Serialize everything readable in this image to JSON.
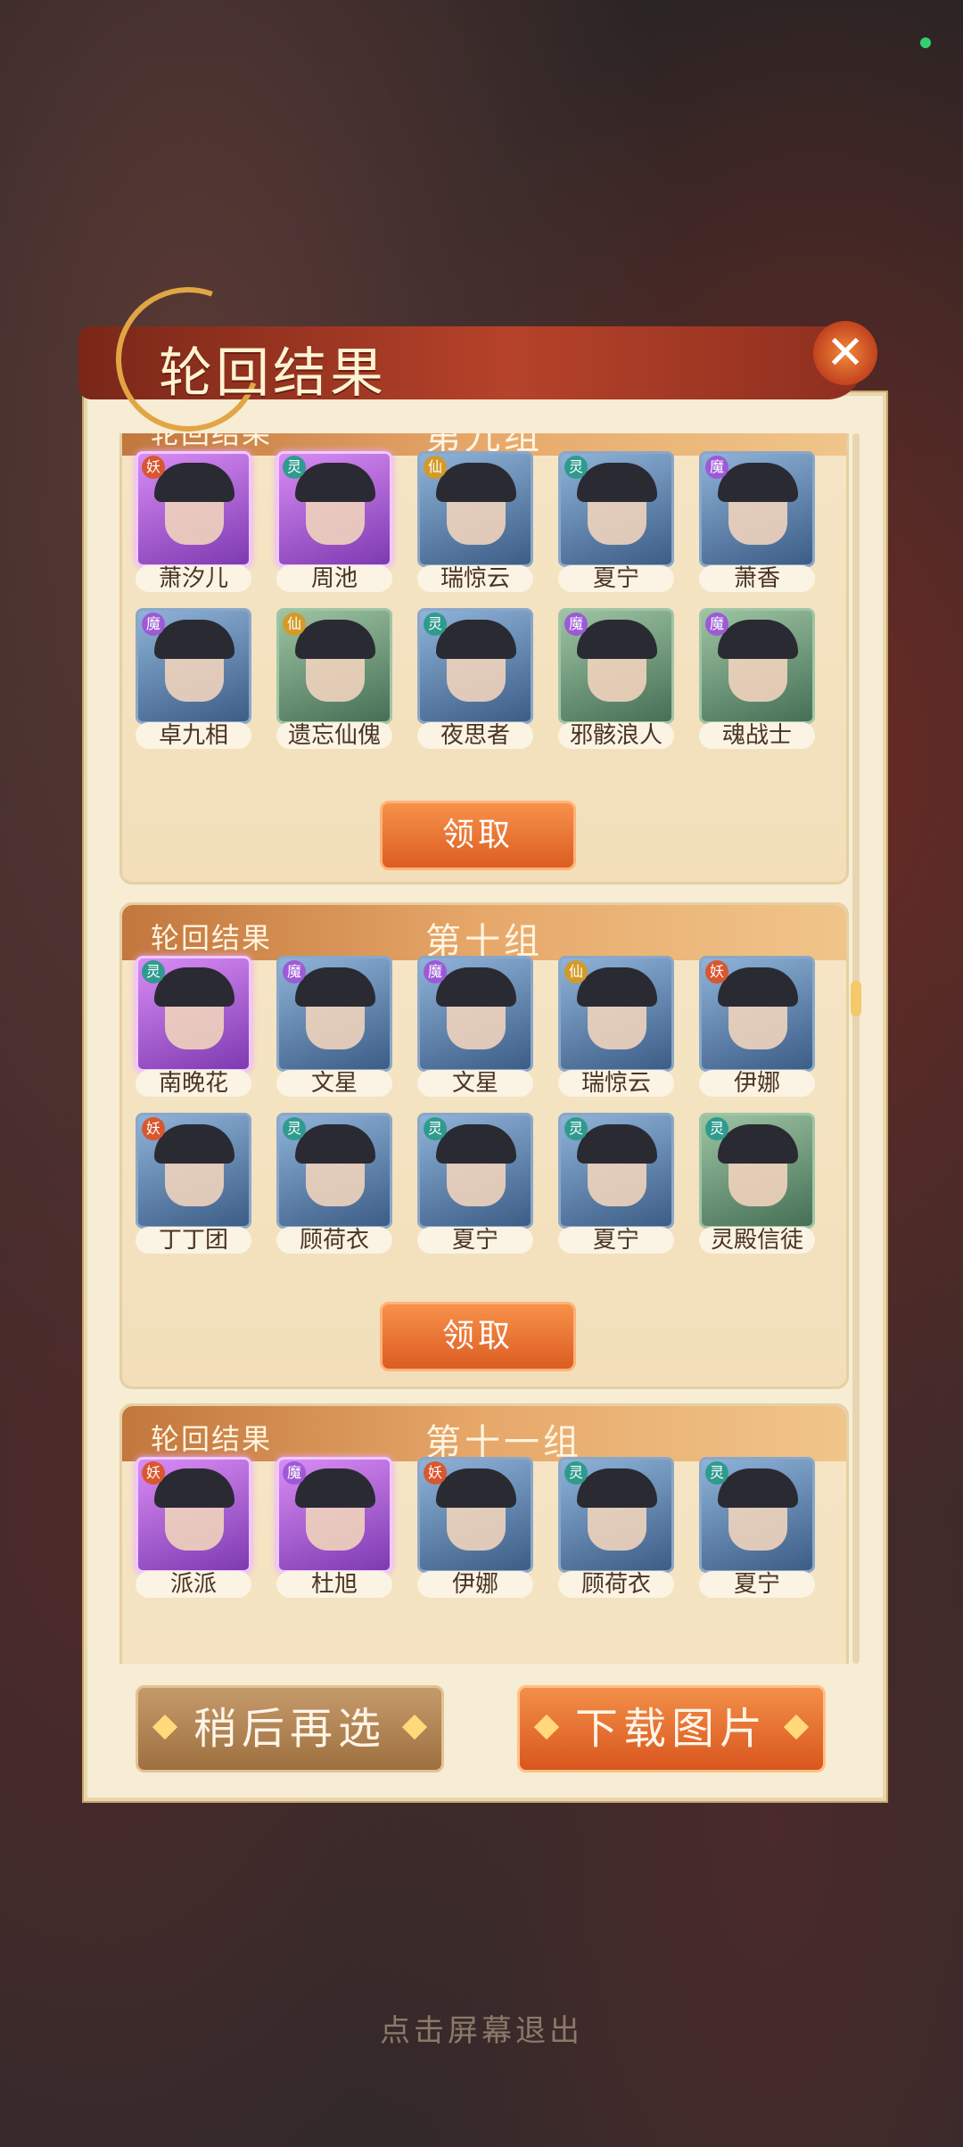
{
  "title": "轮回结果",
  "group_label": "轮回结果",
  "groups": [
    {
      "name": "第九组",
      "cards": [
        {
          "name": "萧汐儿",
          "badge": "妖"
        },
        {
          "name": "周池",
          "badge": "灵"
        },
        {
          "name": "瑞惊云",
          "badge": "仙"
        },
        {
          "name": "夏宁",
          "badge": "灵"
        },
        {
          "name": "萧香",
          "badge": "魔"
        },
        {
          "name": "卓九相",
          "badge": "魔"
        },
        {
          "name": "遗忘仙傀",
          "badge": "仙"
        },
        {
          "name": "夜思者",
          "badge": "灵"
        },
        {
          "name": "邪骸浪人",
          "badge": "魔"
        },
        {
          "name": "魂战士",
          "badge": "魔"
        }
      ],
      "claim": "领取"
    },
    {
      "name": "第十组",
      "cards": [
        {
          "name": "南晚花",
          "badge": "灵"
        },
        {
          "name": "文星",
          "badge": "魔"
        },
        {
          "name": "文星",
          "badge": "魔"
        },
        {
          "name": "瑞惊云",
          "badge": "仙"
        },
        {
          "name": "伊娜",
          "badge": "妖"
        },
        {
          "name": "丁丁团",
          "badge": "妖"
        },
        {
          "name": "顾荷衣",
          "badge": "灵"
        },
        {
          "name": "夏宁",
          "badge": "灵"
        },
        {
          "name": "夏宁",
          "badge": "灵"
        },
        {
          "name": "灵殿信徒",
          "badge": "灵"
        }
      ],
      "claim": "领取"
    },
    {
      "name": "第十一组",
      "cards": [
        {
          "name": "派派",
          "badge": "妖"
        },
        {
          "name": "杜旭",
          "badge": "魔"
        },
        {
          "name": "伊娜",
          "badge": "妖"
        },
        {
          "name": "顾荷衣",
          "badge": "灵"
        },
        {
          "name": "夏宁",
          "badge": "灵"
        }
      ]
    }
  ],
  "buttons": {
    "later": "稍后再选",
    "download": "下载图片"
  },
  "exit_tip": "点击屏幕退出"
}
